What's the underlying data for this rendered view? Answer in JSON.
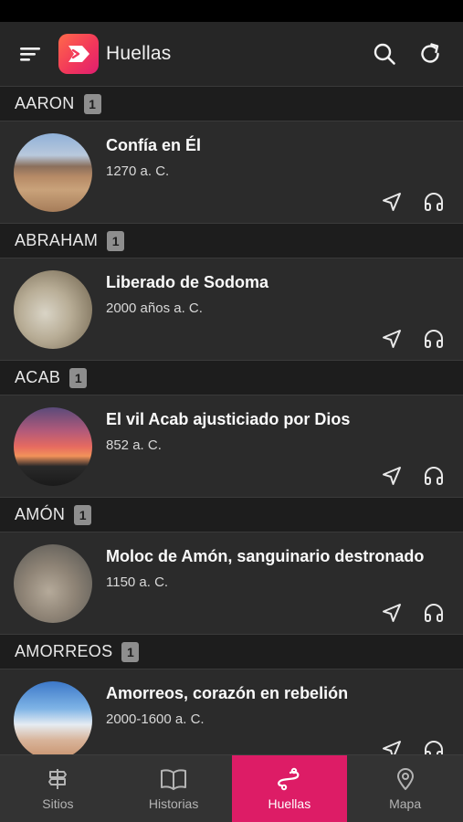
{
  "app": {
    "title": "Huellas"
  },
  "appbar": {
    "menu_icon": "menu-icon",
    "search_icon": "search-icon",
    "refresh_icon": "refresh-icon"
  },
  "sections": [
    {
      "name": "AARON",
      "count": "1",
      "items": [
        {
          "title": "Confía en Él",
          "date": "1270 a. C."
        }
      ]
    },
    {
      "name": "ABRAHAM",
      "count": "1",
      "items": [
        {
          "title": "Liberado de Sodoma",
          "date": "2000 años a. C."
        }
      ]
    },
    {
      "name": "ACAB",
      "count": "1",
      "items": [
        {
          "title": "El vil Acab ajusticiado por Dios",
          "date": "852 a. C."
        }
      ]
    },
    {
      "name": "AMÓN",
      "count": "1",
      "items": [
        {
          "title": "Moloc de Amón, sanguinario destronado",
          "date": "1150 a. C."
        }
      ]
    },
    {
      "name": "AMORREOS",
      "count": "1",
      "items": [
        {
          "title": "Amorreos, corazón en rebelión",
          "date": "2000-1600 a. C."
        }
      ]
    }
  ],
  "bottom_nav": [
    {
      "label": "Sitios",
      "icon": "signpost-icon",
      "active": false
    },
    {
      "label": "Historias",
      "icon": "book-icon",
      "active": false
    },
    {
      "label": "Huellas",
      "icon": "footprints-icon",
      "active": true
    },
    {
      "label": "Mapa",
      "icon": "map-pin-icon",
      "active": false
    }
  ],
  "colors": {
    "accent": "#dd1c66",
    "background": "#2b2b2b",
    "section_header": "#1d1d1d",
    "nav_background": "#333333"
  }
}
